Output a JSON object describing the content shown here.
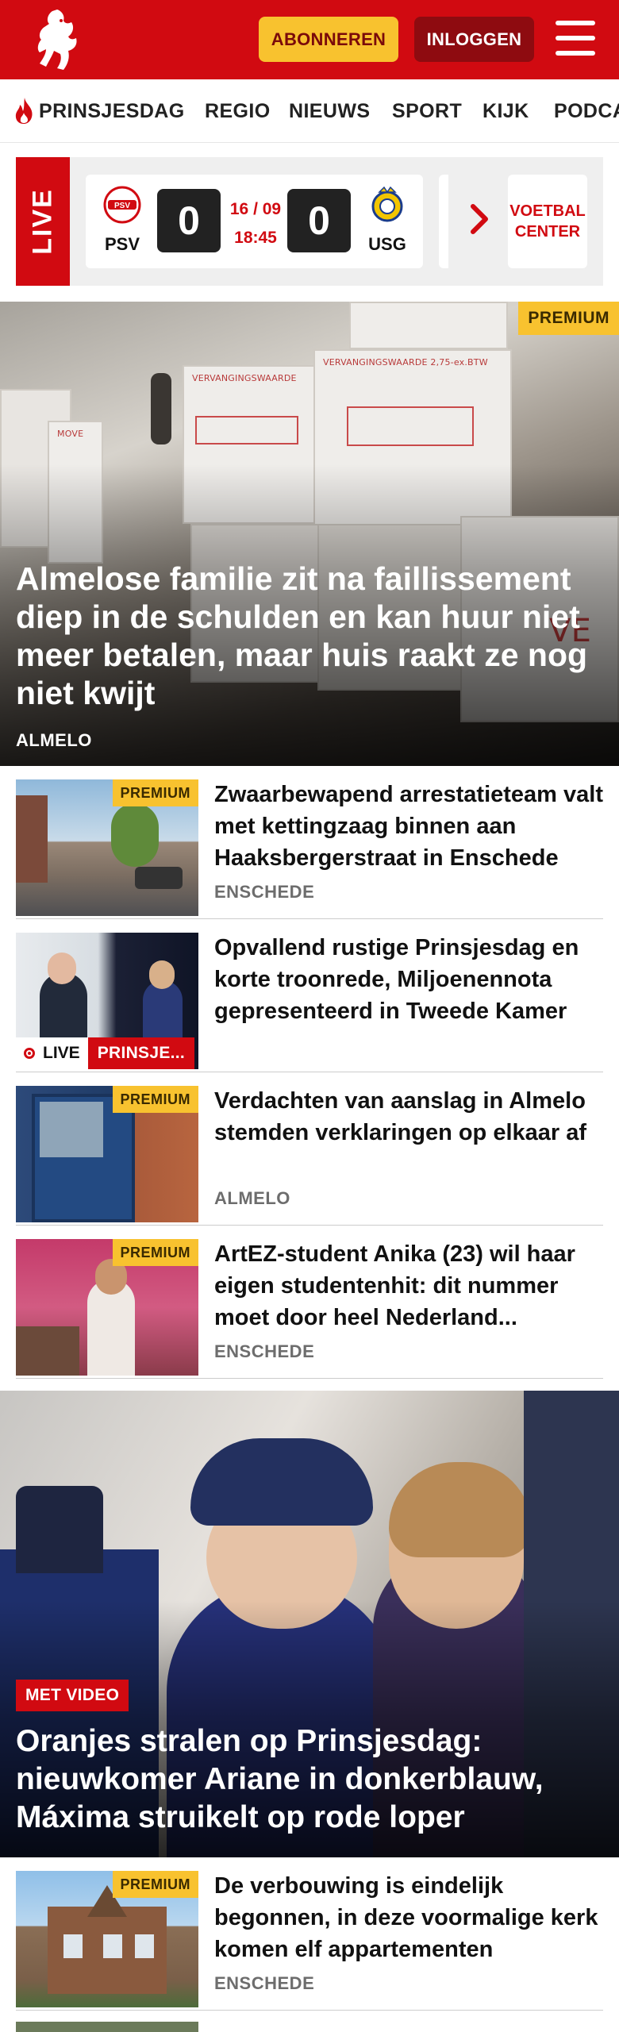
{
  "header": {
    "subscribe_label": "ABONNEREN",
    "login_label": "INLOGGEN",
    "brand_color": "#d10a11",
    "accent_color": "#f8c22f"
  },
  "nav": {
    "items": [
      {
        "label": "PRINSJESDAG",
        "icon": "flame-icon"
      },
      {
        "label": "REGIO"
      },
      {
        "label": "NIEUWS"
      },
      {
        "label": "SPORT"
      },
      {
        "label": "KIJK"
      },
      {
        "label": "PODCA"
      }
    ]
  },
  "live": {
    "tag": "LIVE",
    "match": {
      "home": "PSV",
      "away": "USG",
      "home_score": "0",
      "away_score": "0",
      "date": "16 / 09",
      "time": "18:45"
    },
    "voetbal_center": "VOETBAL CENTER"
  },
  "hero": {
    "badge": "PREMIUM",
    "title": "Almelose familie zit na faillissement diep in de schulden en kan huur niet meer betalen, maar huis raakt ze nog niet kwijt",
    "region": "ALMELO"
  },
  "articles": [
    {
      "badge": "PREMIUM",
      "title": "Zwaarbewapend arrestatieteam valt met kettingzaag binnen aan Haaksbergerstraat in Enschede",
      "region": "ENSCHEDE"
    },
    {
      "live_label": "LIVE",
      "tag": "PRINSJE...",
      "title": "Opvallend rustige Prinsjesdag en korte troonrede, Miljoenennota gepresenteerd in Tweede Kamer"
    },
    {
      "badge": "PREMIUM",
      "title": "Verdachten van aanslag in Almelo stemden verklaringen op elkaar af",
      "region": "ALMELO"
    },
    {
      "badge": "PREMIUM",
      "title": "ArtEZ-student Anika (23) wil haar eigen studentenhit: dit nummer moet door heel Nederland...",
      "region": "ENSCHEDE"
    }
  ],
  "feature": {
    "tag": "MET VIDEO",
    "title": "Oranjes stralen op Prinsjesdag: nieuwkomer Ariane in donkerblauw, Máxima struikelt op rode loper"
  },
  "articles_bottom": [
    {
      "badge": "PREMIUM",
      "title": "De verbouwing is eindelijk begonnen, in deze voormalige kerk komen elf appartementen",
      "region": "ENSCHEDE"
    }
  ]
}
